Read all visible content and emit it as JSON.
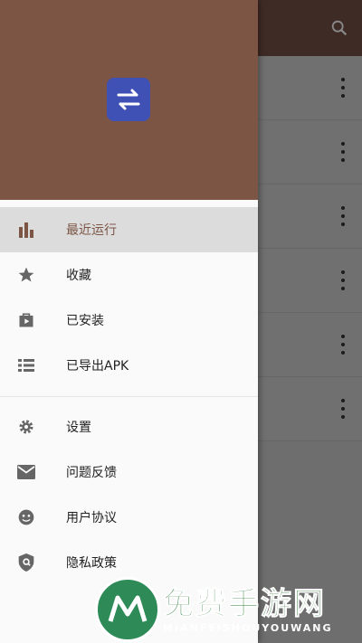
{
  "colors": {
    "header": "#7c5545",
    "toolbar_dim": "#3f2b25",
    "logo_bg": "#4051b5",
    "active_bg": "#dcdcdc"
  },
  "drawer": {
    "logo_icon": "swap-arrows-icon",
    "items": [
      {
        "label": "最近运行",
        "icon": "bar-chart-icon",
        "active": true
      },
      {
        "label": "收藏",
        "icon": "star-icon",
        "active": false
      },
      {
        "label": "已安装",
        "icon": "play-bag-icon",
        "active": false
      },
      {
        "label": "已导出APK",
        "icon": "list-icon",
        "active": false
      }
    ],
    "secondary": [
      {
        "label": "设置",
        "icon": "gear-icon"
      },
      {
        "label": "问题反馈",
        "icon": "mail-icon"
      },
      {
        "label": "用户协议",
        "icon": "face-icon"
      },
      {
        "label": "隐私政策",
        "icon": "shield-icon"
      }
    ]
  },
  "watermark": {
    "title": "免费手游网",
    "subtitle": "MIANFEISHOUYOUWANG"
  }
}
